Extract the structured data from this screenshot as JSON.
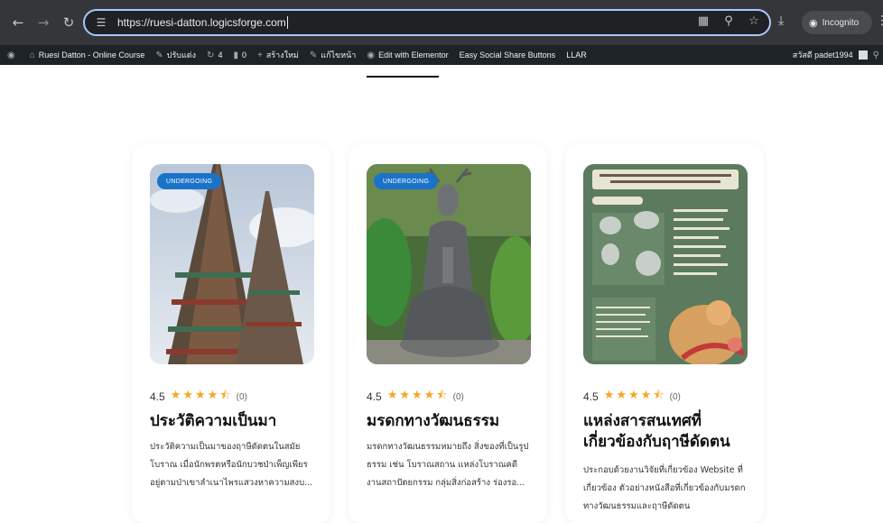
{
  "browser": {
    "url": "https://ruesi-datton.logicsforge.com",
    "incognito_label": "Incognito"
  },
  "admin_bar": {
    "site_name": "Ruesi Datton - Online Course",
    "customize": "ปรับแต่ง",
    "updates_count": "4",
    "comments_count": "0",
    "new_label": "สร้างใหม่",
    "edit_label": "แก้ไขหน้า",
    "elementor_label": "Edit with Elementor",
    "social_label": "Easy Social Share Buttons",
    "llar_label": "LLAR",
    "greeting": "สวัสดี padet1994"
  },
  "cards": [
    {
      "badge": "UNDERGOING",
      "rating": "4.5",
      "stars": "★★★★⯪",
      "count": "(0)",
      "title": "ประวัติความเป็นมา",
      "desc": "ประวัติความเป็นมาของฤาษีดัดตนในสมัยโบราณ เมื่อนักพรตหรือนักบวชป่าเพ็ญเพียรอยู่ตามป่าเขาลำเนาไพรแสวงหาความสงบ..."
    },
    {
      "badge": "UNDERGOING",
      "rating": "4.5",
      "stars": "★★★★⯪",
      "count": "(0)",
      "title": "มรดกทางวัฒนธรรม",
      "desc": "มรดกทางวัฒนธรรมหมายถึง สิ่งของที่เป็นรูปธรรม เช่น โบราณสถาน แหล่งโบราณคดี งานสถาปัตยกรรม กลุ่มสิ่งก่อสร้าง ร่องรอ..."
    },
    {
      "badge": "",
      "rating": "4.5",
      "stars": "★★★★⯪",
      "count": "(0)",
      "title": "แหล่งสารสนเทศที่เกี่ยวข้องกับฤาษีดัดตน",
      "desc": "ประกอบด้วยงานวิจัยที่เกี่ยวข้อง Website ที่เกี่ยวข้อง ตัวอย่างหนังสือที่เกี่ยวข้องกับมรดกทางวัฒนธรรมและฤาษีดัดตน"
    }
  ],
  "colors": {
    "badge": "#1a73c8",
    "star": "#f5a623",
    "admin_bar": "#1d2327",
    "browser_bar": "#35363a"
  }
}
